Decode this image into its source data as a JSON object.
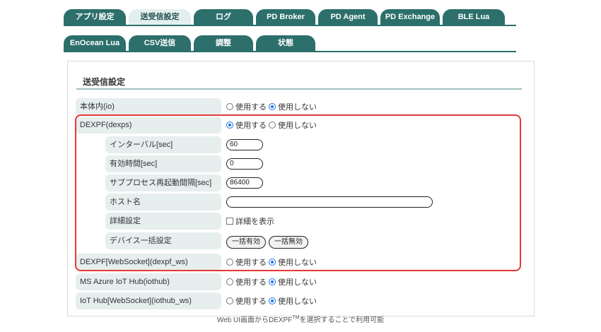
{
  "tabs_row1": [
    {
      "label": "アプリ設定"
    },
    {
      "label": "送受信設定"
    },
    {
      "label": "ログ"
    },
    {
      "label": "PD Broker"
    },
    {
      "label": "PD Agent"
    },
    {
      "label": "PD Exchange"
    },
    {
      "label": "BLE Lua"
    }
  ],
  "tabs_row2": [
    {
      "label": "EnOcean Lua"
    },
    {
      "label": "CSV送信"
    },
    {
      "label": "調整"
    },
    {
      "label": "状態"
    }
  ],
  "active_tab": "送受信設定",
  "section": {
    "title": "送受信設定"
  },
  "radio_labels": {
    "use": "使用する",
    "not_use": "使用しない"
  },
  "rows": {
    "honntai": {
      "label": "本体内(io)",
      "selected": "not_use"
    },
    "dexpf": {
      "label": "DEXPF(dexps)",
      "selected": "use"
    },
    "interval": {
      "label": "インターバル[sec]",
      "value": "60"
    },
    "valid": {
      "label": "有効時間[sec]",
      "value": "0"
    },
    "restart": {
      "label": "サブプロセス再起動間隔[sec]",
      "value": "86400"
    },
    "host": {
      "label": "ホスト名",
      "value": ""
    },
    "detail": {
      "label": "詳細設定",
      "checkbox_label": "詳細を表示",
      "checked": false
    },
    "device": {
      "label": "デバイス一括設定",
      "enable_btn": "一括有効",
      "disable_btn": "一括無効"
    },
    "dexpf_ws": {
      "label": "DEXPF[WebSocket](dexpf_ws)",
      "selected": "not_use"
    },
    "azure": {
      "label": "MS Azure IoT Hub(iothub)",
      "selected": "not_use"
    },
    "iothub_ws": {
      "label": "IoT Hub[WebSocket](iothub_ws)",
      "selected": "not_use"
    }
  },
  "caption": {
    "text": "Web UI画面からDEXPF",
    "sup": "TM",
    "after": "を選択することで利用可能"
  },
  "colors": {
    "tab": "#2c6f6b",
    "tab_active": "#e3efee",
    "label_bg": "#e6eeee",
    "highlight": "#e53935",
    "radio_on": "#1a73e8"
  }
}
